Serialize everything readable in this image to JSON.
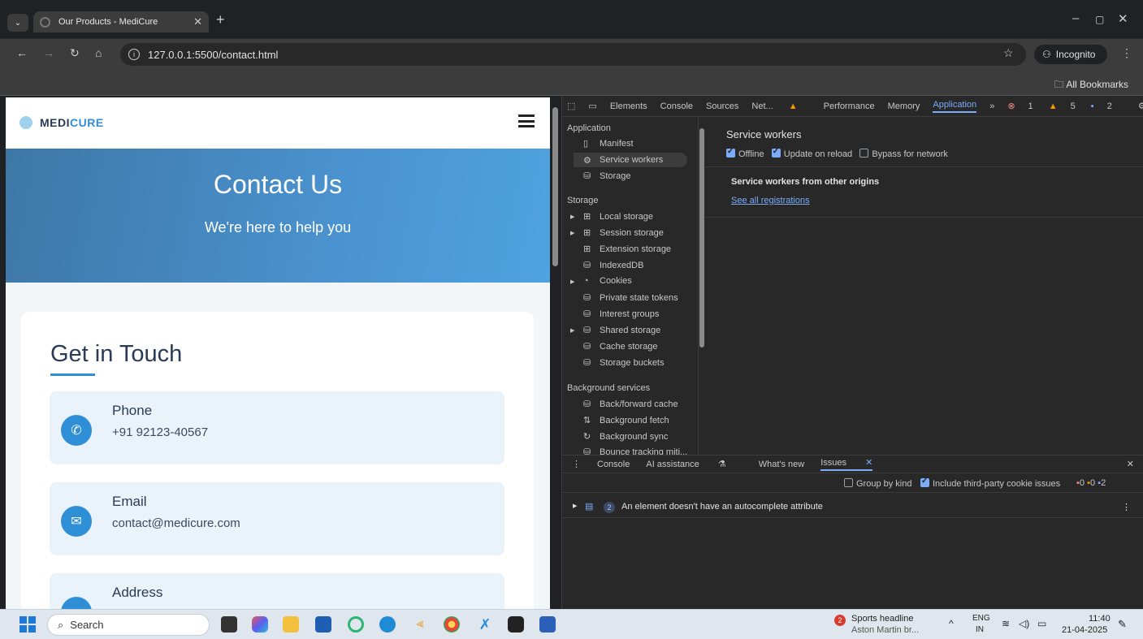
{
  "browser": {
    "tab_title": "Our Products - MediCure",
    "url": "127.0.0.1:5500/contact.html",
    "incognito_label": "Incognito",
    "bookmarks_label": "All Bookmarks"
  },
  "page": {
    "logo_medi": "MEDI",
    "logo_cure": "CURE",
    "hero_title": "Contact Us",
    "hero_subtitle": "We're here to help you",
    "card_title": "Get in Touch",
    "items": [
      {
        "title": "Phone",
        "value": "+91 92123-40567",
        "icon": "phone-icon"
      },
      {
        "title": "Email",
        "value": "contact@medicure.com",
        "icon": "mail-icon"
      },
      {
        "title": "Address",
        "value": "",
        "icon": "location-icon"
      }
    ]
  },
  "devtools": {
    "tabs": [
      "Elements",
      "Console",
      "Sources",
      "Net...",
      "Performance",
      "Memory",
      "Application"
    ],
    "active_tab": "Application",
    "counts": {
      "errors": "1",
      "warnings": "5",
      "info": "2"
    },
    "sidebar": {
      "application_header": "Application",
      "application_items": [
        "Manifest",
        "Service workers",
        "Storage"
      ],
      "storage_header": "Storage",
      "storage_items": [
        "Local storage",
        "Session storage",
        "Extension storage",
        "IndexedDB",
        "Cookies",
        "Private state tokens",
        "Interest groups",
        "Shared storage",
        "Cache storage",
        "Storage buckets"
      ],
      "background_header": "Background services",
      "background_items": [
        "Back/forward cache",
        "Background fetch",
        "Background sync",
        "Bounce tracking miti..."
      ]
    },
    "main": {
      "heading": "Service workers",
      "offline": "Offline",
      "update_on_reload": "Update on reload",
      "bypass": "Bypass for network",
      "other_origins": "Service workers from other origins",
      "see_all": "See all registrations"
    },
    "drawer": {
      "tabs": [
        "Console",
        "AI assistance",
        "What's new",
        "Issues"
      ],
      "active_tab": "Issues",
      "group_by_kind": "Group by kind",
      "include_third_party": "Include third-party cookie issues",
      "badge_counts": [
        "0",
        "0",
        "2"
      ],
      "issue_count": "2",
      "issue_text": "An element doesn't have an autocomplete attribute"
    }
  },
  "taskbar": {
    "search_placeholder": "Search",
    "news_title": "Sports headline",
    "news_sub": "Aston Martin br...",
    "news_badge": "2",
    "lang_top": "ENG",
    "lang_bottom": "IN",
    "time": "11:40",
    "date": "21-04-2025"
  },
  "colors": {
    "accent": "#2f8fd6",
    "devtools_accent": "#7cacf8"
  }
}
